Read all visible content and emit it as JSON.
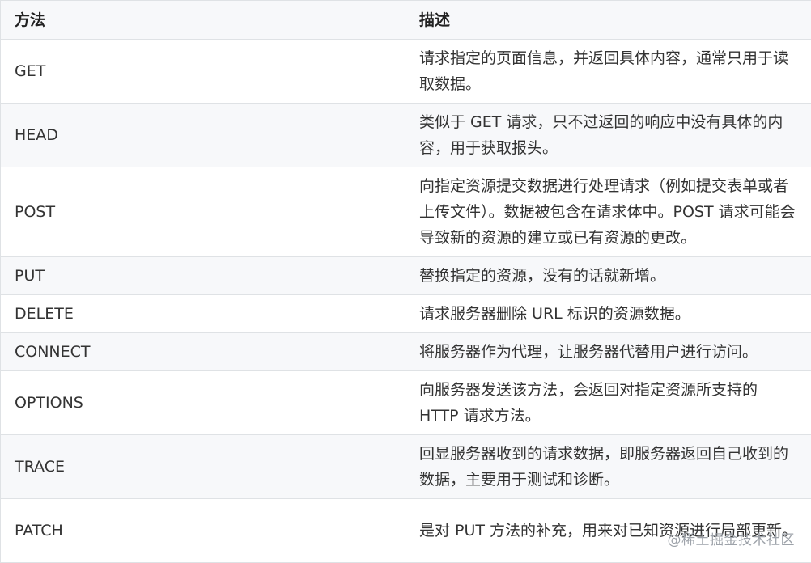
{
  "table": {
    "headers": [
      "方法",
      "描述"
    ],
    "rows": [
      {
        "method": "GET",
        "description": "请求指定的页面信息，并返回具体内容，通常只用于读取数据。"
      },
      {
        "method": "HEAD",
        "description": "类似于 GET 请求，只不过返回的响应中没有具体的内容，用于获取报头。"
      },
      {
        "method": "POST",
        "description": "向指定资源提交数据进行处理请求（例如提交表单或者上传文件）。数据被包含在请求体中。POST 请求可能会导致新的资源的建立或已有资源的更改。"
      },
      {
        "method": "PUT",
        "description": "替换指定的资源，没有的话就新增。"
      },
      {
        "method": "DELETE",
        "description": "请求服务器删除 URL 标识的资源数据。"
      },
      {
        "method": "CONNECT",
        "description": "将服务器作为代理，让服务器代替用户进行访问。"
      },
      {
        "method": "OPTIONS",
        "description": "向服务器发送该方法，会返回对指定资源所支持的 HTTP 请求方法。"
      },
      {
        "method": "TRACE",
        "description": "回显服务器收到的请求数据，即服务器返回自己收到的数据，主要用于测试和诊断。"
      },
      {
        "method": "PATCH",
        "description": "是对 PUT 方法的补充，用来对已知资源进行局部更新。"
      }
    ]
  },
  "watermark": "@稀土掘金技术社区"
}
